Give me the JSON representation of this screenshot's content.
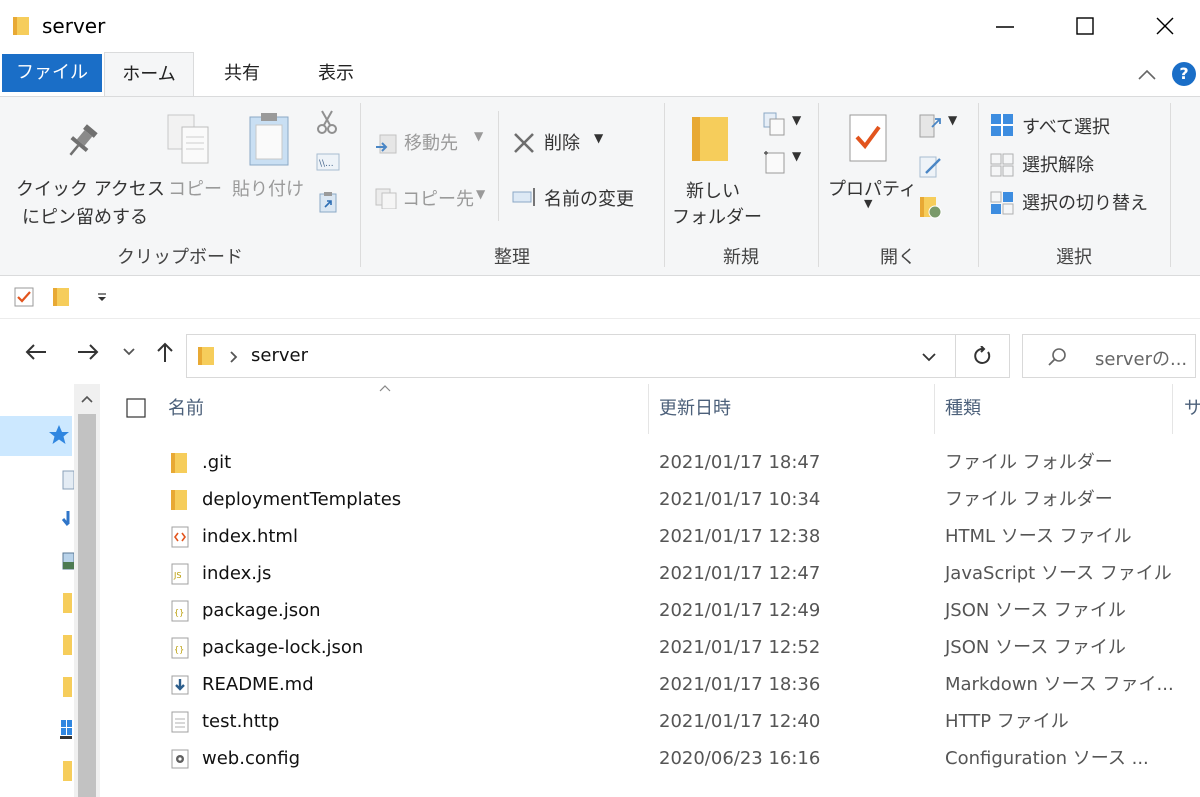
{
  "window": {
    "title": "server",
    "controls": {
      "minimize": "—",
      "maximize": "☐",
      "close": "✕"
    }
  },
  "ribbon_tabs": [
    {
      "label": "ファイル"
    },
    {
      "label": "ホーム"
    },
    {
      "label": "共有"
    },
    {
      "label": "表示"
    }
  ],
  "help_label": "?",
  "ribbon": {
    "clipboard": {
      "pin_label_1": "クイック アクセス",
      "pin_label_2": "にピン留めする",
      "copy_label": "コピー",
      "paste_label": "貼り付け",
      "group_label": "クリップボード"
    },
    "organize": {
      "move_to": "移動先",
      "copy_to": "コピー先",
      "delete": "削除",
      "rename": "名前の変更",
      "group_label": "整理"
    },
    "new": {
      "new_folder_1": "新しい",
      "new_folder_2": "フォルダー",
      "group_label": "新規"
    },
    "open": {
      "properties": "プロパティ",
      "group_label": "開く"
    },
    "select": {
      "select_all": "すべて選択",
      "select_none": "選択解除",
      "invert_selection": "選択の切り替え",
      "group_label": "選択"
    }
  },
  "address": {
    "path": "server"
  },
  "search": {
    "placeholder": "serverの..."
  },
  "columns": {
    "name": "名前",
    "modified": "更新日時",
    "type": "種類",
    "size": "サ"
  },
  "files": [
    {
      "name": ".git",
      "modified": "2021/01/17 18:47",
      "type": "ファイル フォルダー",
      "icon": "folder-icon"
    },
    {
      "name": "deploymentTemplates",
      "modified": "2021/01/17 10:34",
      "type": "ファイル フォルダー",
      "icon": "folder-icon"
    },
    {
      "name": "index.html",
      "modified": "2021/01/17 12:38",
      "type": "HTML ソース ファイル",
      "icon": "html-file-icon"
    },
    {
      "name": "index.js",
      "modified": "2021/01/17 12:47",
      "type": "JavaScript ソース ファイル",
      "icon": "js-file-icon"
    },
    {
      "name": "package.json",
      "modified": "2021/01/17 12:49",
      "type": "JSON ソース ファイル",
      "icon": "json-file-icon"
    },
    {
      "name": "package-lock.json",
      "modified": "2021/01/17 12:52",
      "type": "JSON ソース ファイル",
      "icon": "json-file-icon"
    },
    {
      "name": "README.md",
      "modified": "2021/01/17 18:36",
      "type": "Markdown ソース ファイ...",
      "icon": "markdown-file-icon"
    },
    {
      "name": "test.http",
      "modified": "2021/01/17 12:40",
      "type": "HTTP ファイル",
      "icon": "text-file-icon"
    },
    {
      "name": "web.config",
      "modified": "2020/06/23 16:16",
      "type": "Configuration ソース ...",
      "icon": "config-file-icon"
    }
  ],
  "colors": {
    "accent": "#1a6ec7",
    "folder": "#f4c24d",
    "ribbon_bg": "#f5f6f7",
    "selection": "#cce8ff"
  }
}
